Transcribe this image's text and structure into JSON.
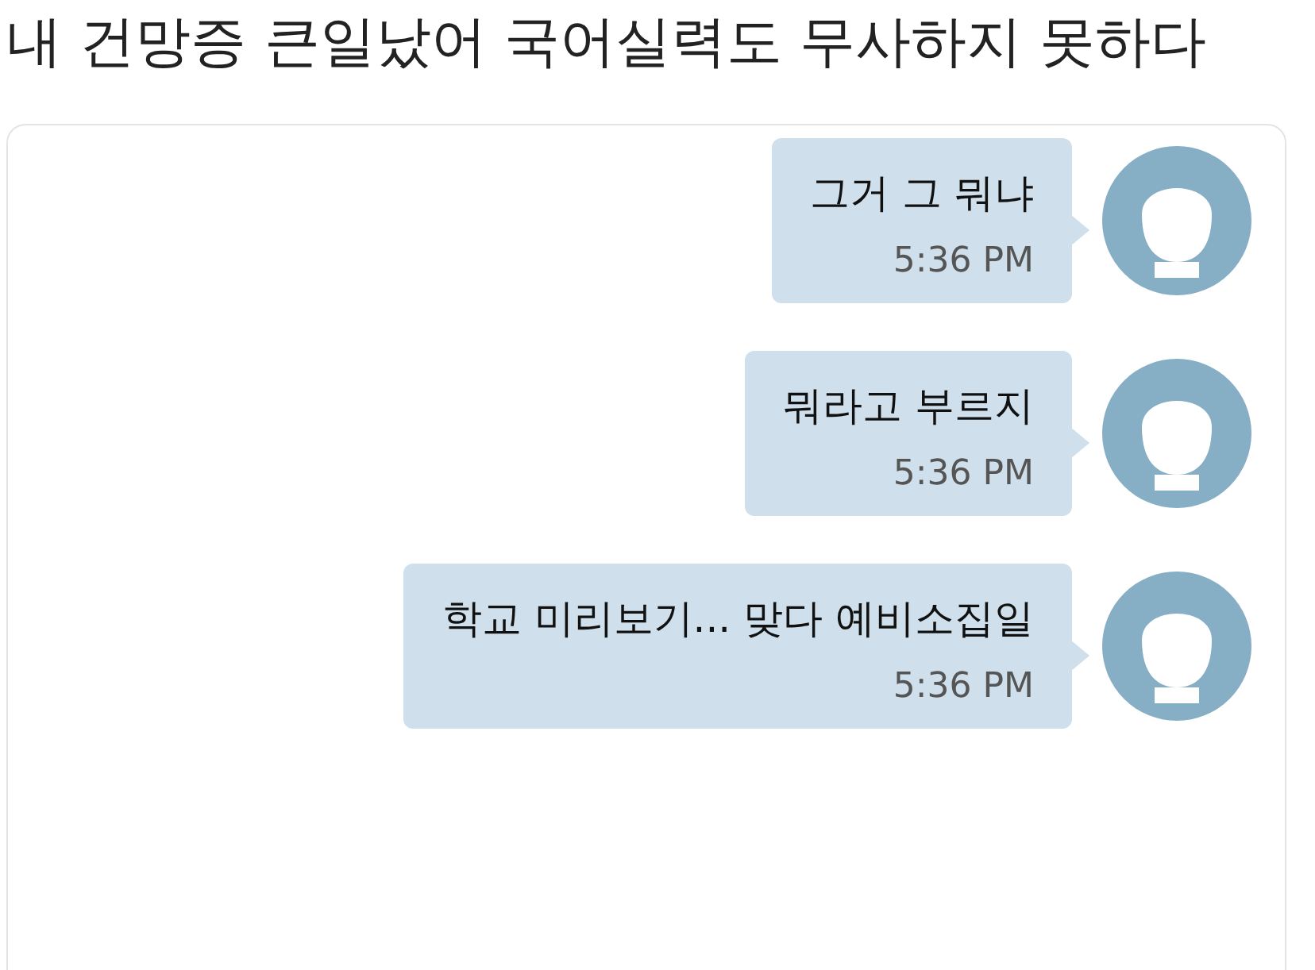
{
  "title": "내 건망증 큰일났어 국어실력도 무사하지 못하다",
  "messages": [
    {
      "text": "그거 그 뭐냐",
      "time": "5:36 PM"
    },
    {
      "text": "뭐라고 부르지",
      "time": "5:36 PM"
    },
    {
      "text": "학교 미리보기... 맞다 예비소집일",
      "time": "5:36 PM"
    }
  ]
}
